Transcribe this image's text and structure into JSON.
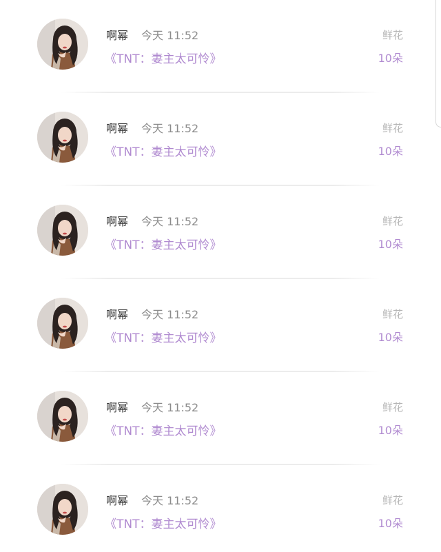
{
  "entries": [
    {
      "user": "啊幂",
      "time": "今天 11:52",
      "book": "《TNT：妻主太可怜》",
      "gift": "鲜花",
      "count": "10朵"
    },
    {
      "user": "啊幂",
      "time": "今天 11:52",
      "book": "《TNT：妻主太可怜》",
      "gift": "鲜花",
      "count": "10朵"
    },
    {
      "user": "啊幂",
      "time": "今天 11:52",
      "book": "《TNT：妻主太可怜》",
      "gift": "鲜花",
      "count": "10朵"
    },
    {
      "user": "啊幂",
      "time": "今天 11:52",
      "book": "《TNT：妻主太可怜》",
      "gift": "鲜花",
      "count": "10朵"
    },
    {
      "user": "啊幂",
      "time": "今天 11:52",
      "book": "《TNT：妻主太可怜》",
      "gift": "鲜花",
      "count": "10朵"
    },
    {
      "user": "啊幂",
      "time": "今天 11:52",
      "book": "《TNT：妻主太可怜》",
      "gift": "鲜花",
      "count": "10朵"
    }
  ],
  "colors": {
    "accent": "#b08ad0",
    "name": "#3a3a3a",
    "time": "#8c8c8c",
    "gift": "#b6b6b6"
  },
  "icons": {
    "avatar": "user-avatar-photo"
  }
}
